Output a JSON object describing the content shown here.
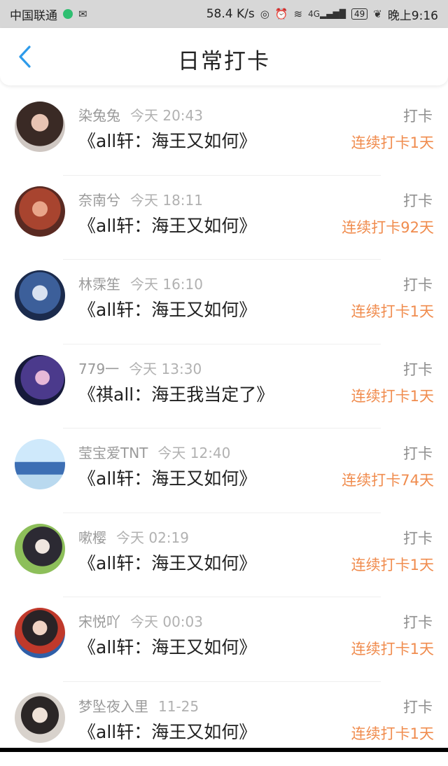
{
  "status_bar": {
    "carrier": "中国联通",
    "speed": "58.4 K/s",
    "network": "4G",
    "battery": "49",
    "time": "晚上9:16"
  },
  "header": {
    "title": "日常打卡",
    "back_icon": "chevron-left-icon",
    "accent_color": "#2e9bea"
  },
  "colors": {
    "streak": "#f08c4e",
    "username": "#9a9a9a"
  },
  "entries": [
    {
      "user": "染兔兔",
      "time": "今天 20:43",
      "book": "《all轩：海王又如何》",
      "action": "打卡",
      "streak": "连续打卡1天"
    },
    {
      "user": "奈南兮",
      "time": "今天 18:11",
      "book": "《all轩：海王又如何》",
      "action": "打卡",
      "streak": "连续打卡92天"
    },
    {
      "user": "林霂笙",
      "time": "今天 16:10",
      "book": "《all轩：海王又如何》",
      "action": "打卡",
      "streak": "连续打卡1天"
    },
    {
      "user": "779一",
      "time": "今天 13:30",
      "book": "《祺all：海王我当定了》",
      "action": "打卡",
      "streak": "连续打卡1天"
    },
    {
      "user": "莹宝爱TNT",
      "time": "今天 12:40",
      "book": "《all轩：海王又如何》",
      "action": "打卡",
      "streak": "连续打卡74天"
    },
    {
      "user": "嗽樱",
      "time": "今天 02:19",
      "book": "《all轩：海王又如何》",
      "action": "打卡",
      "streak": "连续打卡1天"
    },
    {
      "user": "宋悦吖",
      "time": "今天 00:03",
      "book": "《all轩：海王又如何》",
      "action": "打卡",
      "streak": "连续打卡1天"
    },
    {
      "user": "梦坠夜入里",
      "time": "11-25",
      "book": "《all轩：海王又如何》",
      "action": "打卡",
      "streak": "连续打卡1天"
    }
  ]
}
